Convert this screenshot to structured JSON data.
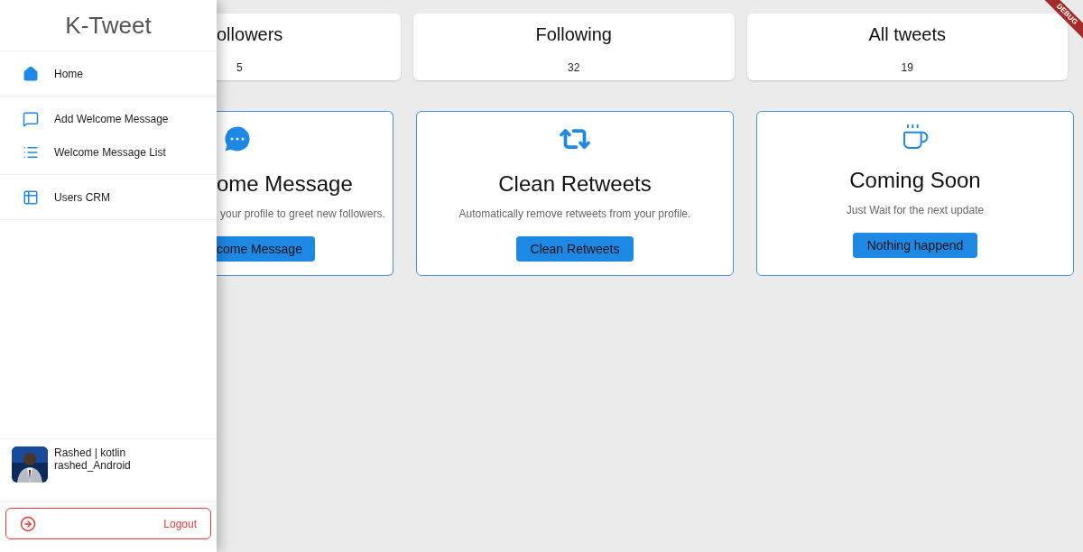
{
  "drawer": {
    "title": "K-Tweet",
    "sections": [
      [
        {
          "kind": "home",
          "label": "Home"
        }
      ],
      [
        {
          "kind": "chat",
          "label": "Add Welcome Message"
        },
        {
          "kind": "list",
          "label": "Welcome Message List"
        }
      ],
      [
        {
          "kind": "table",
          "label": "Users CRM"
        }
      ]
    ],
    "user": {
      "name": "Rashed | kotlin",
      "handle": "rashed_Android"
    },
    "logout": "Logout"
  },
  "stats": [
    {
      "label": "ollowers",
      "value": "5"
    },
    {
      "label": "Following",
      "value": "32"
    },
    {
      "label": "All tweets",
      "value": "19"
    }
  ],
  "features": [
    {
      "kind": "chat",
      "title": "ome Message",
      "description": "your profile to greet new followers.",
      "button": "come Message"
    },
    {
      "kind": "retweet",
      "title": "Clean Retweets",
      "description": "Automatically remove retweets from your profile.",
      "button": "Clean Retweets"
    },
    {
      "kind": "java",
      "title": "Coming Soon",
      "description": "Just Wait for the next update",
      "button": "Nothing happend"
    }
  ],
  "debug_banner": "DEBUG"
}
